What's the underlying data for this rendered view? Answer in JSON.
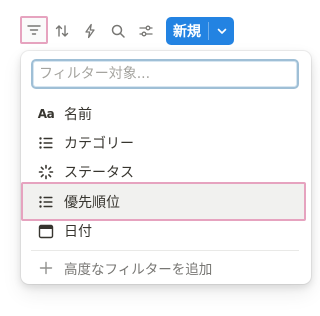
{
  "toolbar": {
    "icons": [
      "filter-icon",
      "sort-icon",
      "lightning-icon",
      "search-icon",
      "settings-sliders-icon"
    ],
    "new_button_label": "新規",
    "accent_color": "#2383e2",
    "highlight_color": "#e6a3bf"
  },
  "filter_menu": {
    "search_placeholder": "フィルター対象...",
    "search_value": "",
    "items": [
      {
        "label": "名前",
        "icon_text": "Aa",
        "icon": "text-property-icon"
      },
      {
        "label": "カテゴリー",
        "icon": "list-icon"
      },
      {
        "label": "ステータス",
        "icon": "status-icon"
      },
      {
        "label": "優先順位",
        "icon": "list-icon"
      },
      {
        "label": "日付",
        "icon": "calendar-icon"
      }
    ],
    "advanced_label": "高度なフィルターを追加",
    "advanced_icon": "plus-icon"
  }
}
